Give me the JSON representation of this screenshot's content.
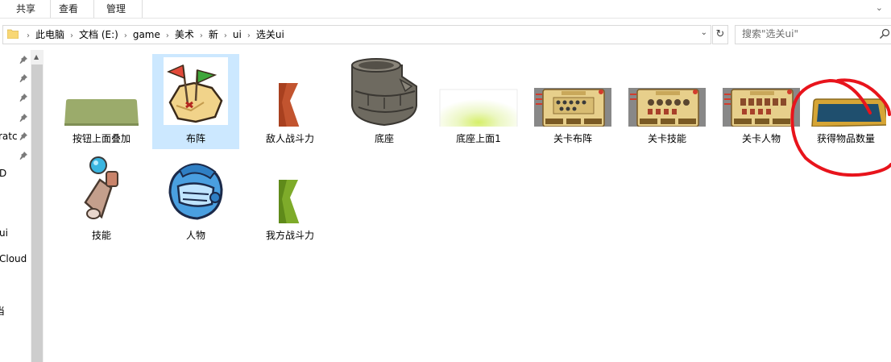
{
  "ribbon": {
    "tabs": [
      "共享",
      "查看",
      "管理"
    ]
  },
  "address": {
    "crumbs": [
      "此电脑",
      "文档 (E:)",
      "game",
      "美术",
      "新",
      "ui",
      "选关ui"
    ]
  },
  "search": {
    "placeholder": "搜索\"选关ui\""
  },
  "nav_labels": [
    "ratc",
    "D",
    "ui",
    "Cloud F",
    "当"
  ],
  "files": [
    {
      "name": "按钮上面叠加",
      "icon": "green-bar-thumbnail"
    },
    {
      "name": "布阵",
      "icon": "flags-map-thumbnail"
    },
    {
      "name": "敌人战斗力",
      "icon": "red-ribbon-thumbnail"
    },
    {
      "name": "底座",
      "icon": "stone-base-thumbnail"
    },
    {
      "name": "底座上面1",
      "icon": "glow-thumbnail"
    },
    {
      "name": "关卡布阵",
      "icon": "level-panel-thumbnail"
    },
    {
      "name": "关卡技能",
      "icon": "level-panel-thumbnail"
    },
    {
      "name": "关卡人物",
      "icon": "level-panel-thumbnail"
    },
    {
      "name": "获得物品数量",
      "icon": "blue-frame-thumbnail"
    },
    {
      "name": "技能",
      "icon": "scroll-wand-thumbnail"
    },
    {
      "name": "人物",
      "icon": "knight-helmet-thumbnail"
    },
    {
      "name": "我方战斗力",
      "icon": "green-ribbon-thumbnail"
    }
  ],
  "colors": {
    "selection": "#cce8ff",
    "annotation": "#e8141c"
  }
}
